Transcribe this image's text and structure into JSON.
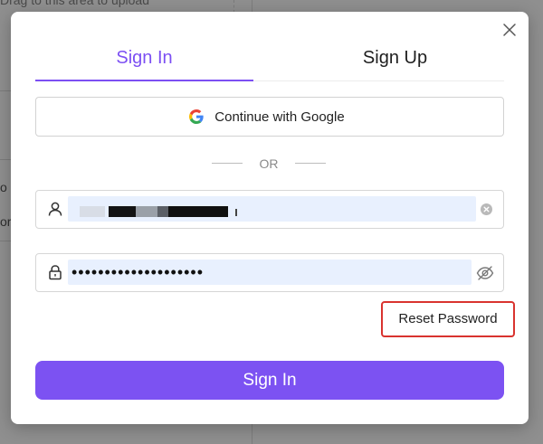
{
  "background": {
    "upload_hint": "Drag to this area to upload",
    "fragment_1": "o",
    "fragment_2": "orm"
  },
  "modal": {
    "close_icon": "close-icon",
    "tabs": [
      {
        "label": "Sign In",
        "active": true
      },
      {
        "label": "Sign Up",
        "active": false
      }
    ],
    "google_button": {
      "label": "Continue with Google",
      "icon": "google-icon"
    },
    "divider_text": "OR",
    "username": {
      "icon": "user-icon",
      "value": "",
      "clear_icon": "clear-icon"
    },
    "password": {
      "icon": "lock-icon",
      "value": "••••••••••••••••••••",
      "visibility_icon": "eye-off-icon"
    },
    "reset_password_label": "Reset Password",
    "submit_label": "Sign In"
  },
  "colors": {
    "accent": "#7c52f2",
    "highlight_border": "#d9332f",
    "autofill_bg": "#e8f0fe"
  }
}
